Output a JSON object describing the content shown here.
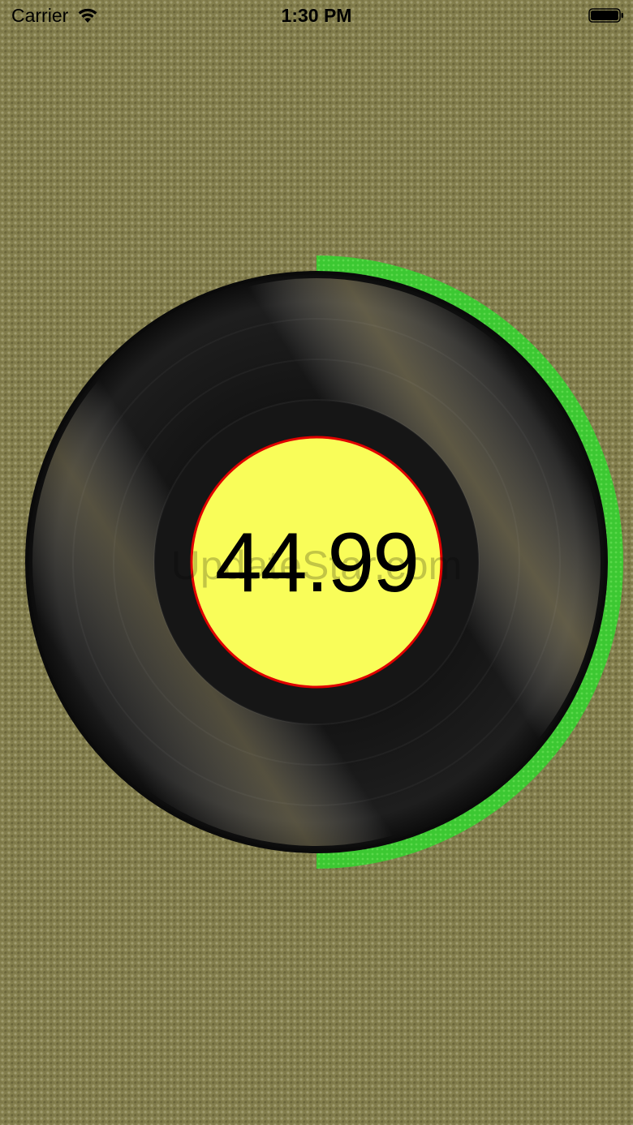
{
  "status_bar": {
    "carrier": "Carrier",
    "time": "1:30 PM",
    "icons": [
      "wifi-icon",
      "battery-icon"
    ]
  },
  "gauge": {
    "value_label": "44.99",
    "progress_fraction": 0.5,
    "colors": {
      "progress": "#3cc832",
      "center": "#f9fd59",
      "center_border": "#e00000",
      "record": "#141414"
    }
  },
  "watermark": "UpdateStar.com"
}
